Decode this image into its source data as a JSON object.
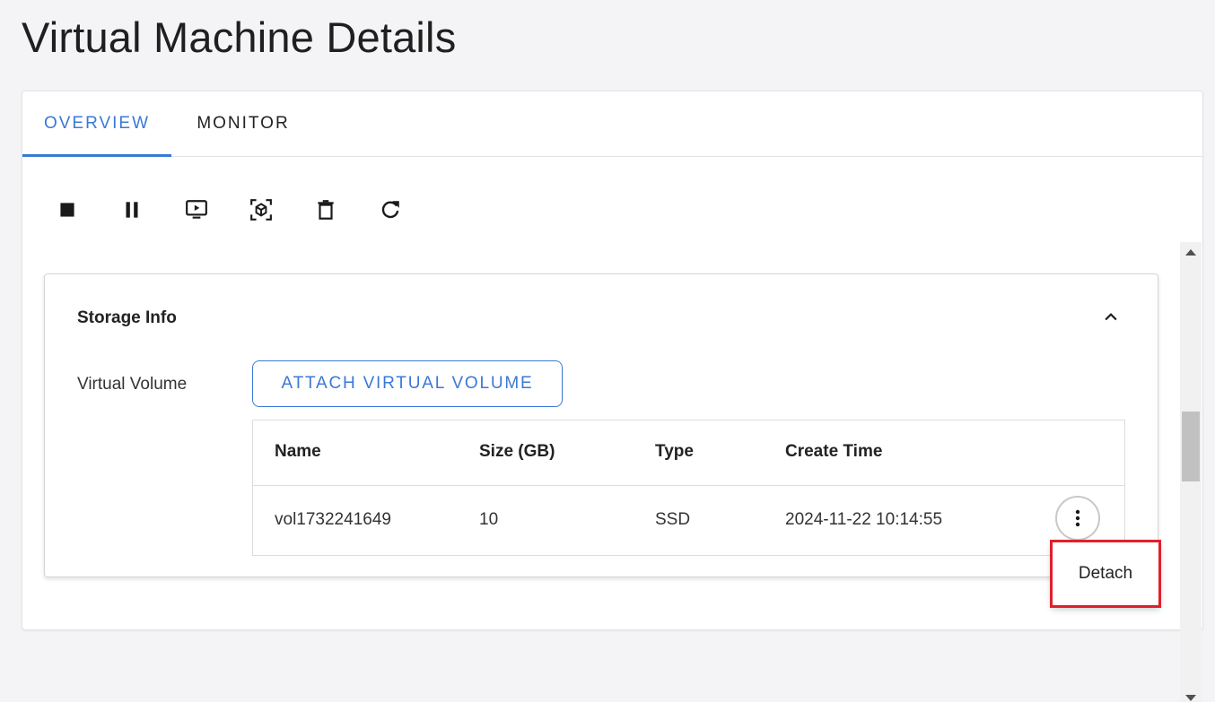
{
  "page": {
    "title": "Virtual Machine Details"
  },
  "tabs": [
    {
      "label": "OVERVIEW",
      "active": true
    },
    {
      "label": "MONITOR",
      "active": false
    }
  ],
  "toolbar": {
    "icons": [
      "stop-icon",
      "pause-icon",
      "console-icon",
      "snapshot-icon",
      "delete-icon",
      "restart-icon"
    ]
  },
  "storage": {
    "title": "Storage Info",
    "virtual_volume_label": "Virtual Volume",
    "attach_button": "ATTACH VIRTUAL VOLUME",
    "table": {
      "headers": [
        "Name",
        "Size (GB)",
        "Type",
        "Create Time"
      ],
      "rows": [
        {
          "name": "vol1732241649",
          "size": "10",
          "type": "SSD",
          "create_time": "2024-11-22 10:14:55"
        }
      ]
    }
  },
  "context_menu": {
    "items": [
      "Detach"
    ]
  },
  "colors": {
    "accent": "#3a78d8",
    "highlight": "#e0202a"
  }
}
